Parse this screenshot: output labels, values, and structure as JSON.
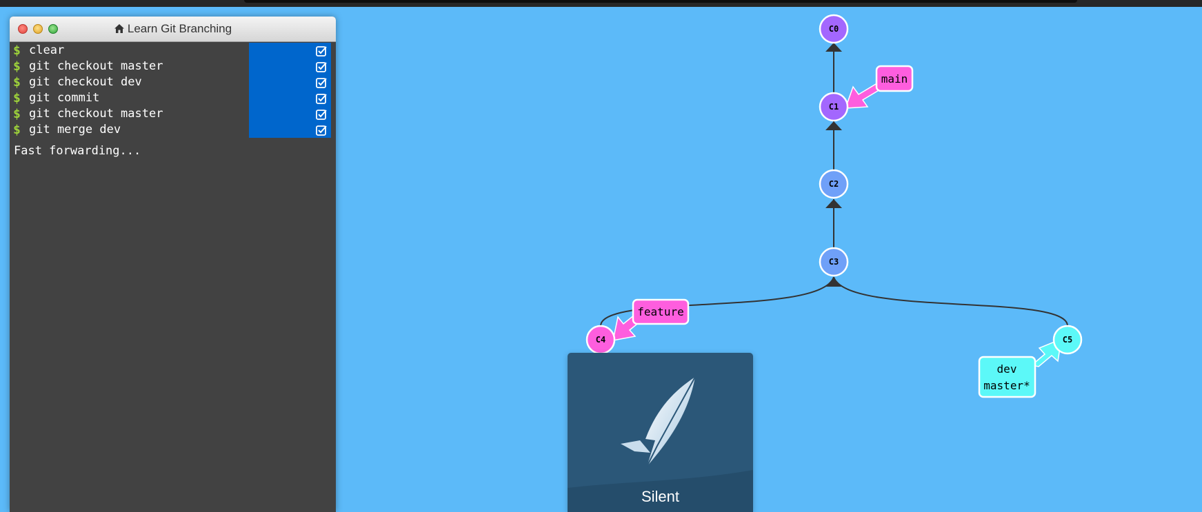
{
  "terminal": {
    "title": "Learn Git Branching",
    "title_icon": "home-icon",
    "prompt": "$",
    "commands": [
      {
        "text": "clear",
        "done": true
      },
      {
        "text": "git checkout master",
        "done": true
      },
      {
        "text": "git checkout dev",
        "done": true
      },
      {
        "text": "git commit",
        "done": true
      },
      {
        "text": "git checkout master",
        "done": true
      },
      {
        "text": "git merge dev",
        "done": true
      }
    ],
    "output": "Fast forwarding..."
  },
  "graph": {
    "commits": [
      {
        "id": "C0",
        "color": "#a367fe"
      },
      {
        "id": "C1",
        "color": "#a367fe"
      },
      {
        "id": "C2",
        "color": "#6fa0f8"
      },
      {
        "id": "C3",
        "color": "#6fa0f8"
      },
      {
        "id": "C4",
        "color": "#fe5ede"
      },
      {
        "id": "C5",
        "color": "#5cf8f8"
      }
    ],
    "branches": [
      {
        "name": "main",
        "target": "C1",
        "color": "#fe5ede"
      },
      {
        "name": "feature",
        "target": "C4",
        "color": "#fe5ede"
      },
      {
        "name": "dev",
        "target": "C5",
        "color": "#5cf8f8"
      },
      {
        "name": "master*",
        "target": "C5",
        "color": "#5cf8f8"
      }
    ]
  },
  "popup": {
    "name": "Silent",
    "icon": "feather-logo-icon"
  },
  "colors": {
    "background": "#5cbaf9",
    "terminal_bg": "#424242",
    "check_bg": "#0066cc",
    "prompt": "#9ed23a",
    "edge": "#333333"
  }
}
